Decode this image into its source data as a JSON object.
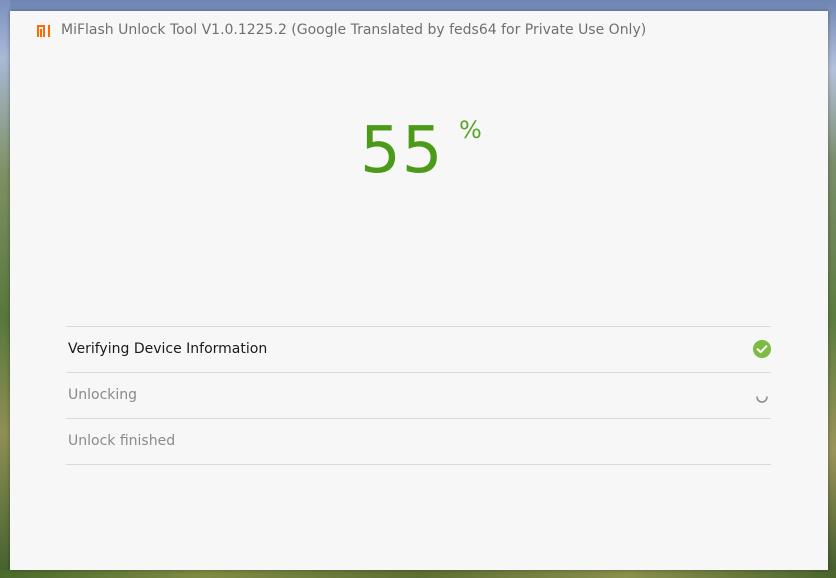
{
  "window": {
    "title": "MiFlash Unlock Tool V1.0.1225.2 (Google Translated by feds64 for Private Use Only)",
    "logo_icon": "mi-logo-icon",
    "brand_color": "#ff6900"
  },
  "progress": {
    "value": "55",
    "unit": "%",
    "color": "#4c9a1a"
  },
  "steps": [
    {
      "label": "Verifying Device Information",
      "status": "done",
      "icon": "check-circle-icon"
    },
    {
      "label": "Unlocking",
      "status": "in-progress",
      "icon": "spinner-icon"
    },
    {
      "label": "Unlock finished",
      "status": "pending"
    }
  ]
}
